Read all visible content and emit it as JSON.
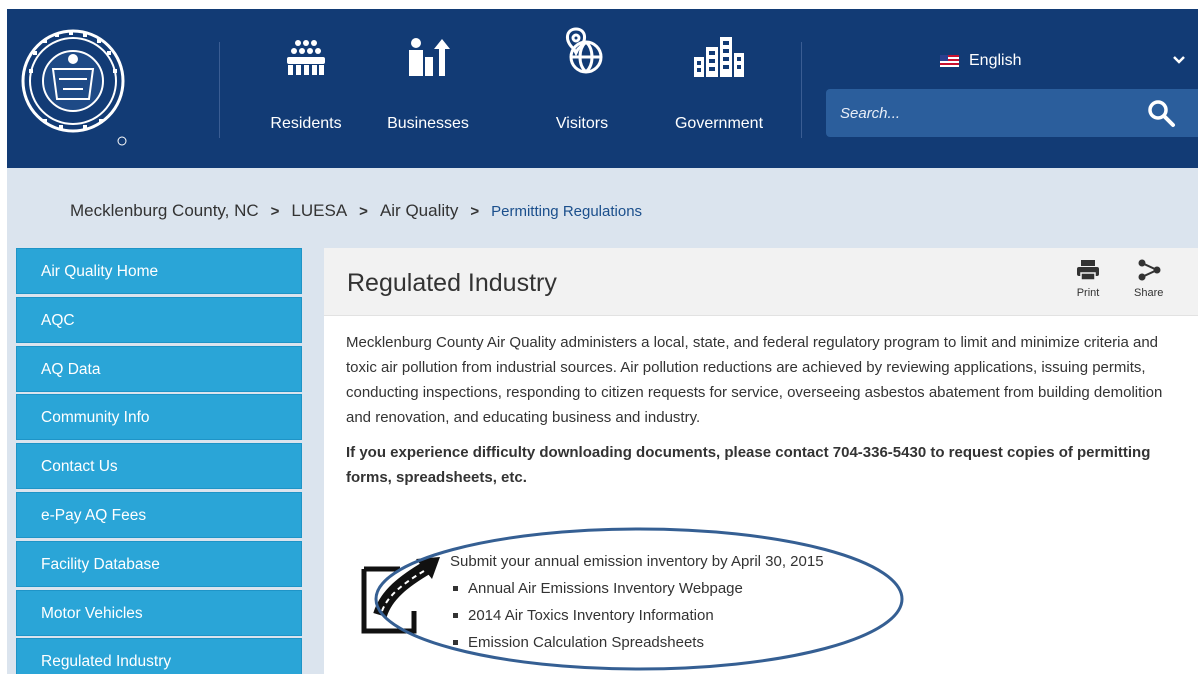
{
  "header": {
    "nav": [
      {
        "label": "Residents",
        "icon": "people-group-icon"
      },
      {
        "label": "Businesses",
        "icon": "person-growth-icon"
      },
      {
        "label": "Visitors",
        "icon": "globe-pin-icon"
      },
      {
        "label": "Government",
        "icon": "buildings-icon"
      }
    ],
    "language": "English",
    "search_placeholder": "Search...",
    "colors": {
      "header_bg": "#123b75",
      "search_bg": "#2b5e9c"
    }
  },
  "breadcrumb": {
    "items": [
      "Mecklenburg County, NC",
      "LUESA",
      "Air Quality"
    ],
    "current": "Permitting Regulations"
  },
  "sidebar": {
    "items": [
      "Air Quality Home",
      "AQC",
      "AQ Data",
      "Community Info",
      "Contact Us",
      "e-Pay AQ Fees",
      "Facility Database",
      "Motor Vehicles",
      "Regulated Industry"
    ],
    "color": "#2aa5d7"
  },
  "page": {
    "title": "Regulated Industry",
    "print_label": "Print",
    "share_label": "Share",
    "intro": "Mecklenburg County Air Quality administers a local, state, and federal regulatory program to limit and minimize criteria and toxic air pollution from industrial sources. Air pollution reductions are achieved by reviewing applications, issuing permits, conducting inspections, responding to citizen requests for service, overseeing asbestos abatement from building demolition and renovation, and educating business and industry.",
    "contact_notice": "If you experience difficulty downloading documents, please contact 704-336-5430 to request copies of permitting forms, spreadsheets, etc.",
    "inventory": {
      "heading": "Submit your annual emission inventory by April 30, 2015",
      "links": [
        "Annual Air Emissions Inventory Webpage",
        "2014 Air Toxics Inventory Information",
        "Emission Calculation Spreadsheets"
      ]
    }
  }
}
